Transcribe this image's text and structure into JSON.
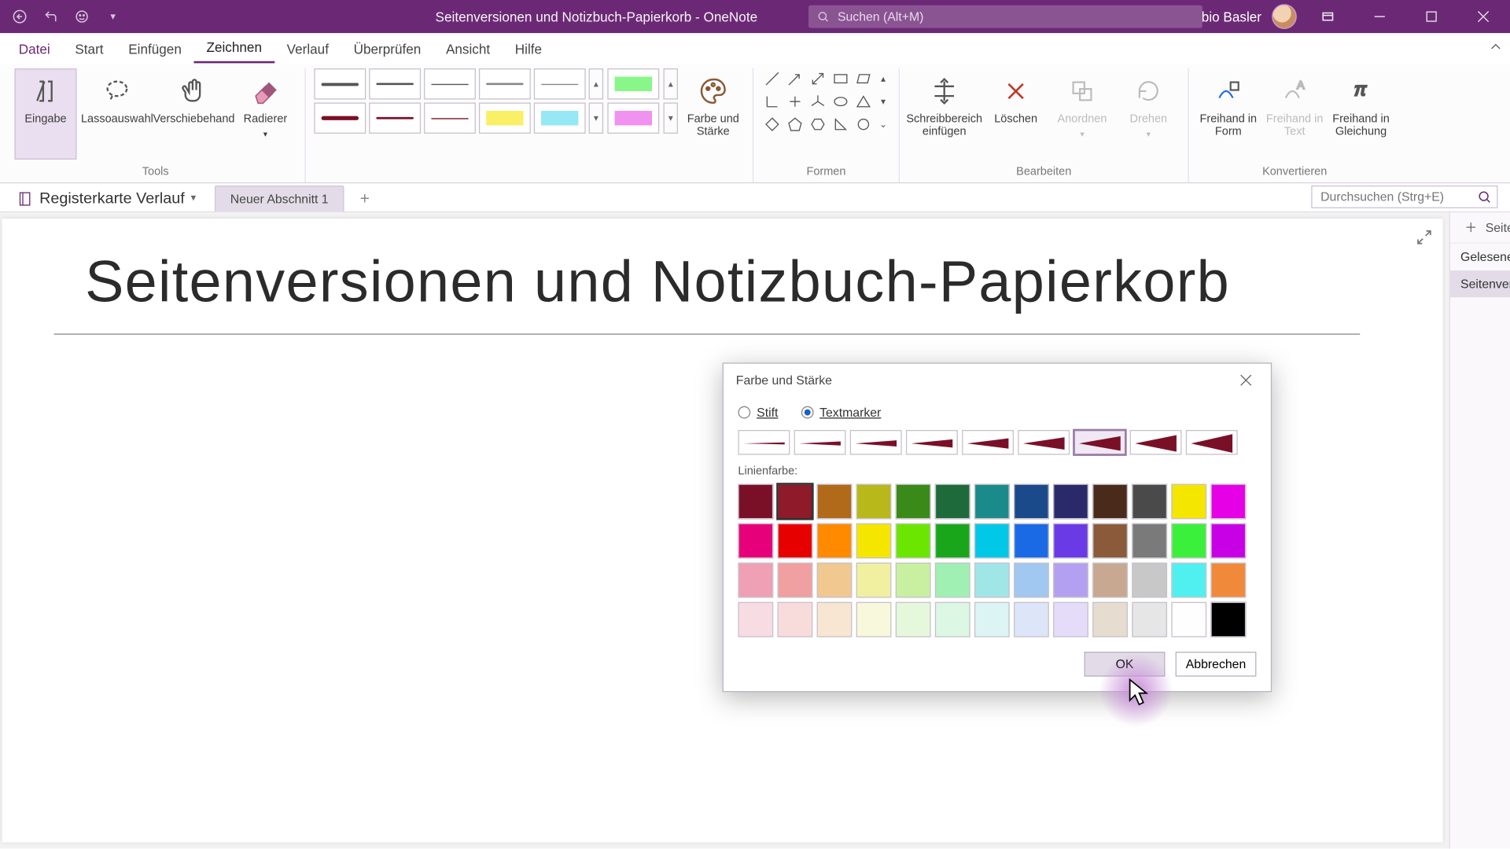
{
  "titlebar": {
    "doc_title": "Seitenversionen und Notizbuch-Papierkorb  -  OneNote",
    "search_placeholder": "Suchen (Alt+M)",
    "user": "Fabio Basler"
  },
  "ribbon_tabs": [
    "Datei",
    "Start",
    "Einfügen",
    "Zeichnen",
    "Verlauf",
    "Überprüfen",
    "Ansicht",
    "Hilfe"
  ],
  "ribbon_active": "Zeichnen",
  "ribbon": {
    "tools_group": "Tools",
    "eingabe": "Eingabe",
    "lasso": "Lassoauswahl",
    "verschiebehand": "Verschiebehand",
    "radierer": "Radierer",
    "farbe_staerke": "Farbe und Stärke",
    "formen_group": "Formen",
    "bearbeiten_group": "Bearbeiten",
    "schreibbereich": "Schreibbereich einfügen",
    "loeschen": "Löschen",
    "anordnen": "Anordnen",
    "drehen": "Drehen",
    "konvertieren_group": "Konvertieren",
    "freihand_form": "Freihand in Form",
    "freihand_text": "Freihand in Text",
    "freihand_gleichung": "Freihand in Gleichung"
  },
  "notebook": {
    "name": "Registerkarte Verlauf",
    "section": "Neuer Abschnitt 1",
    "search_placeholder": "Durchsuchen (Strg+E)"
  },
  "page": {
    "title": "Seitenversionen und Notizbuch-Papierkorb"
  },
  "side": {
    "add": "Seite hinzufügen",
    "items": [
      "Gelesene Abschnitte und Autoren",
      "Seitenversionen und Notizbuch-P"
    ]
  },
  "dialog": {
    "title": "Farbe und Stärke",
    "stift": "Stift",
    "textmarker": "Textmarker",
    "linienfarbe": "Linienfarbe:",
    "ok": "OK",
    "cancel": "Abbrechen",
    "thick_selected": 6,
    "colors_row1": [
      "#7a1028",
      "#8f1a2a",
      "#b06a1a",
      "#b8b81a",
      "#3a8a1a",
      "#1e6a3a",
      "#1a8a8a",
      "#1a4a8a",
      "#2a2a6a",
      "#4a2a1a",
      "#4a4a4a",
      "#f5e600",
      "#e600e6"
    ],
    "colors_row2": [
      "#e6007a",
      "#e60000",
      "#ff8a00",
      "#f5e600",
      "#6ae600",
      "#1aa61a",
      "#00c8e6",
      "#1a6ae6",
      "#6a3ae6",
      "#8a5a3a",
      "#7a7a7a",
      "#3af03a",
      "#c800e6"
    ],
    "colors_row3": [
      "#f0a0b4",
      "#f0a0a0",
      "#f0c890",
      "#f0f0a0",
      "#c8f0a0",
      "#a0f0b4",
      "#a0e6e6",
      "#a0c8f0",
      "#b4a0f0",
      "#c8a890",
      "#c8c8c8",
      "#50f0f0",
      "#f08a3a"
    ],
    "colors_row4": [
      "#f8dce4",
      "#f8dcdc",
      "#f8e6d2",
      "#f8f8dc",
      "#e6f8dc",
      "#dcf8e4",
      "#dcf4f4",
      "#dce6f8",
      "#e4dcf8",
      "#e6dccf",
      "#e6e6e6",
      "#fefefe",
      "#000000"
    ],
    "selected_color": "#8f1a2a"
  }
}
